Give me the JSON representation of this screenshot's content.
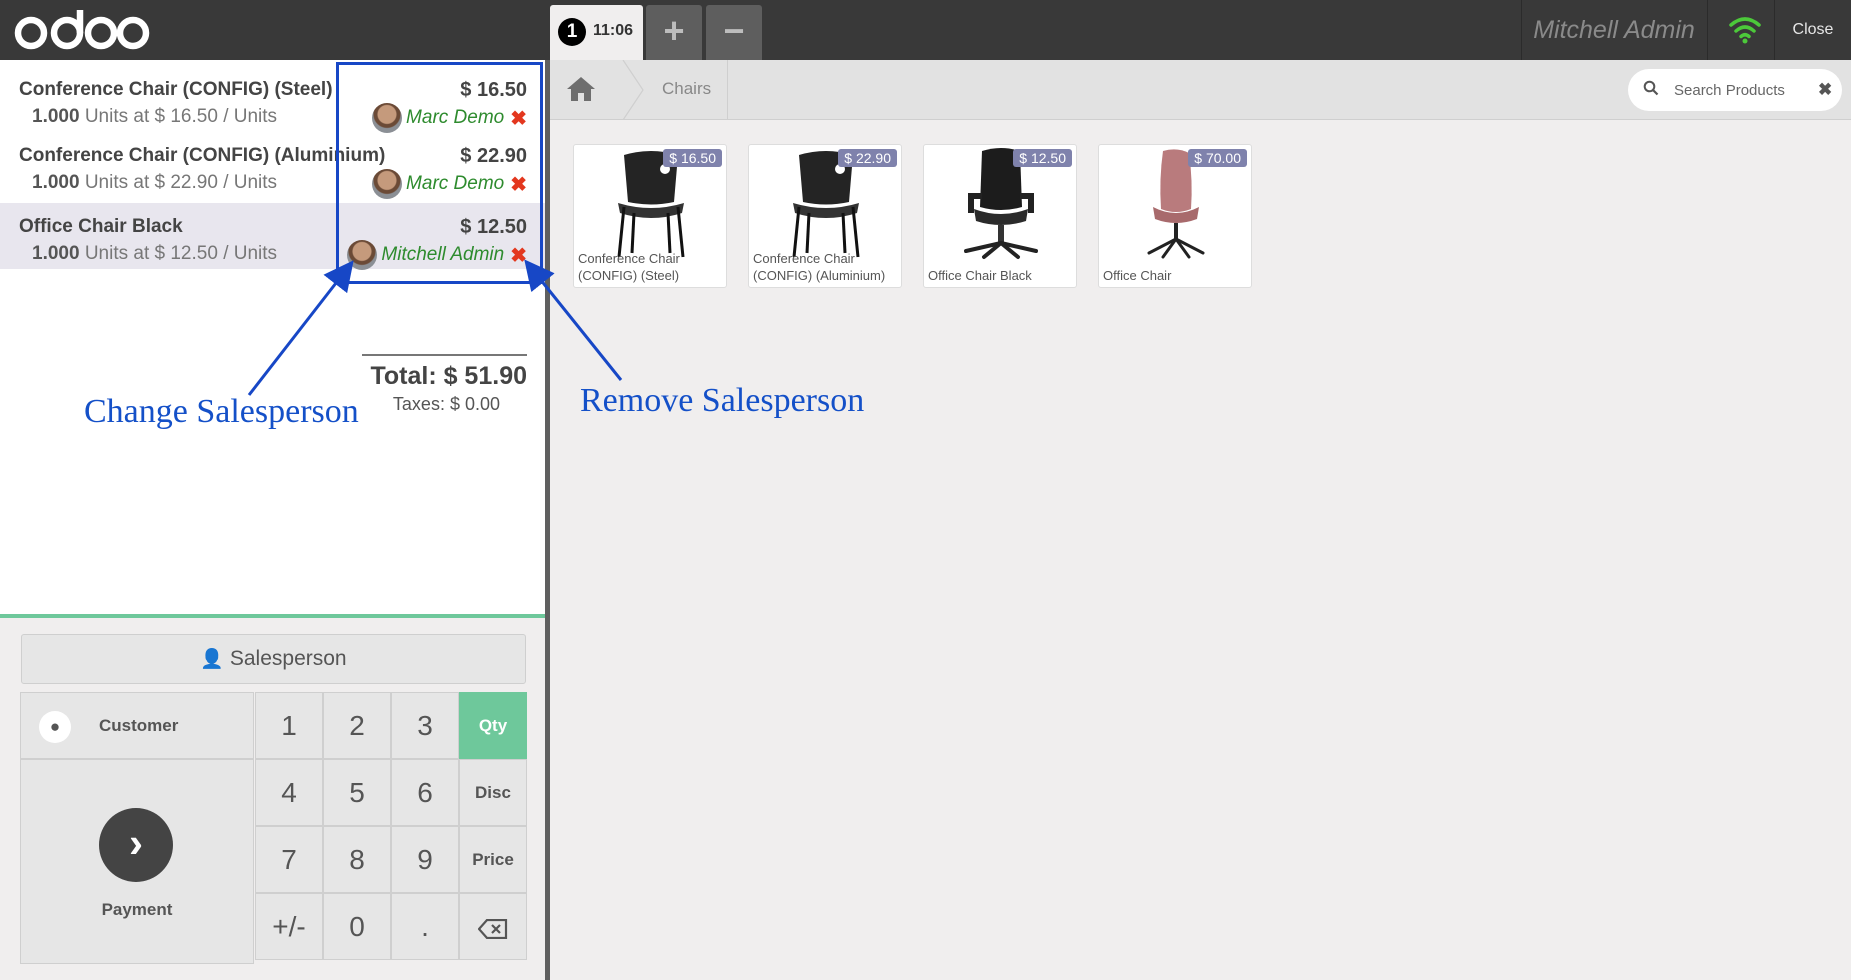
{
  "header": {
    "logo_text": "odoo",
    "order_number": "1",
    "order_time": "11:06",
    "add_order_label": "+",
    "remove_order_label": "−",
    "user_name": "Mitchell Admin",
    "close_label": "Close",
    "wifi_color": "#4cc93a"
  },
  "order": {
    "lines": [
      {
        "name": "Conference Chair (CONFIG) (Steel)",
        "qty": "1.000",
        "info": "Units at $ 16.50 / Units",
        "price": "$ 16.50",
        "salesperson": "Marc Demo",
        "selected": false
      },
      {
        "name": "Conference Chair (CONFIG) (Aluminium)",
        "qty": "1.000",
        "info": "Units at $ 22.90 / Units",
        "price": "$ 22.90",
        "salesperson": "Marc Demo",
        "selected": false
      },
      {
        "name": "Office Chair Black",
        "qty": "1.000",
        "info": "Units at $ 12.50 / Units",
        "price": "$ 12.50",
        "salesperson": "Mitchell Admin",
        "selected": true
      }
    ],
    "total": "Total: $ 51.90",
    "taxes": "Taxes: $ 0.00"
  },
  "annotations": {
    "change": "Change Salesperson",
    "remove": "Remove Salesperson",
    "color": "#1747c6"
  },
  "controls": {
    "salesperson_button": "Salesperson",
    "customer": "Customer",
    "payment": "Payment",
    "keys": [
      "1",
      "2",
      "3",
      "4",
      "5",
      "6",
      "7",
      "8",
      "9",
      "+/-",
      "0",
      "."
    ],
    "modes": [
      "Qty",
      "Disc",
      "Price"
    ],
    "active_mode": "Qty",
    "accent": "#6ec89b"
  },
  "breadcrumb": {
    "home_icon": "home-icon",
    "category": "Chairs"
  },
  "search": {
    "placeholder": "Search Products",
    "value": ""
  },
  "products": [
    {
      "name": "Conference Chair (CONFIG) (Steel)",
      "price": "$ 16.50"
    },
    {
      "name": "Conference Chair (CONFIG) (Aluminium)",
      "price": "$ 22.90"
    },
    {
      "name": "Office Chair Black",
      "price": "$ 12.50"
    },
    {
      "name": "Office Chair",
      "price": "$ 70.00"
    }
  ]
}
